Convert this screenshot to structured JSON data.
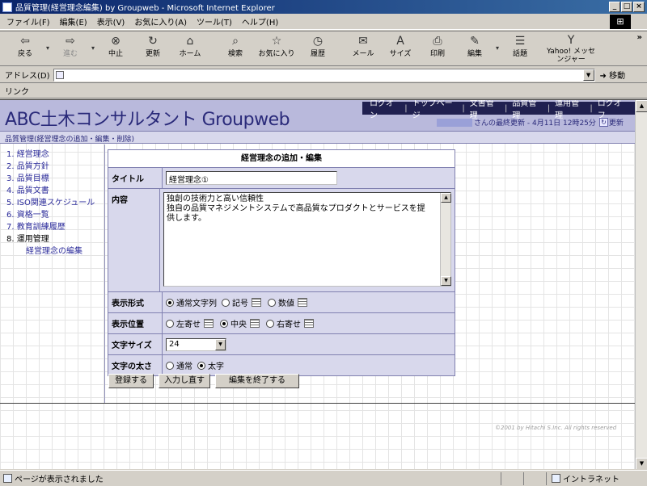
{
  "window": {
    "title": "品質管理(経営理念編集) by Groupweb - Microsoft Internet Explorer",
    "controls": [
      "_",
      "□",
      "×"
    ]
  },
  "menu": {
    "items": [
      "ファイル(F)",
      "編集(E)",
      "表示(V)",
      "お気に入り(A)",
      "ツール(T)",
      "ヘルプ(H)"
    ]
  },
  "toolbar": {
    "buttons": [
      {
        "label": "戻る",
        "icon": "back-arrow-icon",
        "glyph": "⇦"
      },
      {
        "label": "進む",
        "icon": "forward-arrow-icon",
        "glyph": "⇨"
      },
      {
        "label": "中止",
        "icon": "stop-icon",
        "glyph": "⊗"
      },
      {
        "label": "更新",
        "icon": "refresh-icon",
        "glyph": "↻"
      },
      {
        "label": "ホーム",
        "icon": "home-icon",
        "glyph": "⌂"
      },
      {
        "label": "検索",
        "icon": "search-icon",
        "glyph": "⌕"
      },
      {
        "label": "お気に入り",
        "icon": "favorites-icon",
        "glyph": "☆"
      },
      {
        "label": "履歴",
        "icon": "history-icon",
        "glyph": "◷"
      },
      {
        "label": "メール",
        "icon": "mail-icon",
        "glyph": "✉"
      },
      {
        "label": "サイズ",
        "icon": "font-size-icon",
        "glyph": "A"
      },
      {
        "label": "印刷",
        "icon": "print-icon",
        "glyph": "⎙"
      },
      {
        "label": "編集",
        "icon": "edit-icon",
        "glyph": "✎"
      },
      {
        "label": "話題",
        "icon": "discuss-icon",
        "glyph": "☰"
      },
      {
        "label": "Yahoo! メッセンジャー",
        "icon": "messenger-icon",
        "glyph": "Y"
      }
    ],
    "more": "»"
  },
  "address": {
    "label": "アドレス(D)",
    "value": "",
    "go_label": "移動"
  },
  "links": {
    "label": "リンク"
  },
  "site": {
    "brand": "ABC土木コンサルタント Groupweb",
    "top_nav": [
      "ログオン",
      "トップページ",
      "文書管理",
      "品質管理",
      "運用管理",
      "ログオフ"
    ],
    "last_update_text": "さんの最終更新 - 4月11日 12時25分",
    "reload_label": "更新",
    "breadcrumb": "品質管理(経営理念の追加・編集・削除)"
  },
  "sidebar": {
    "items": [
      {
        "label": "1. 経営理念"
      },
      {
        "label": "2. 品質方針"
      },
      {
        "label": "3. 品質目標"
      },
      {
        "label": "4. 品質文書"
      },
      {
        "label": "5. ISO関連スケジュール"
      },
      {
        "label": "6. 資格一覧"
      },
      {
        "label": "7. 教育訓練履歴"
      },
      {
        "label": "8. 運用管理"
      },
      {
        "label": "経営理念の編集"
      }
    ]
  },
  "form": {
    "heading": "経営理念の追加・編集",
    "title_label": "タイトル",
    "title_value": "経営理念①",
    "content_label": "内容",
    "content_lines": [
      "独創の技術力と高い信頼性",
      "独自の品質マネジメントシステムで高品質なプロダクトとサービスを提",
      "供します。"
    ],
    "display_format_label": "表示形式",
    "display_format_options": [
      "通常文字列",
      "記号",
      "数値"
    ],
    "display_format_selected": "通常文字列",
    "position_label": "表示位置",
    "position_options": [
      "左寄せ",
      "中央",
      "右寄せ"
    ],
    "position_selected": "中央",
    "font_size_label": "文字サイズ",
    "font_size_value": "24",
    "weight_label": "文字の太さ",
    "weight_options": [
      "通常",
      "太字"
    ],
    "weight_selected": "太字"
  },
  "actions": {
    "register": "登録する",
    "reset": "入力し直す",
    "finish": "編集を終了する"
  },
  "footer": {
    "copyright": "©2001 by Hitachi S.Inc. All rights reserved"
  },
  "status": {
    "text": "ページが表示されました",
    "zone": "イントラネット"
  },
  "colors": {
    "header_bg": "#b9b9dc",
    "nav_bg": "#202050",
    "label_bg": "#d8d8ec",
    "link_color": "#2a2a9a",
    "title_bar": "#0a246a"
  }
}
